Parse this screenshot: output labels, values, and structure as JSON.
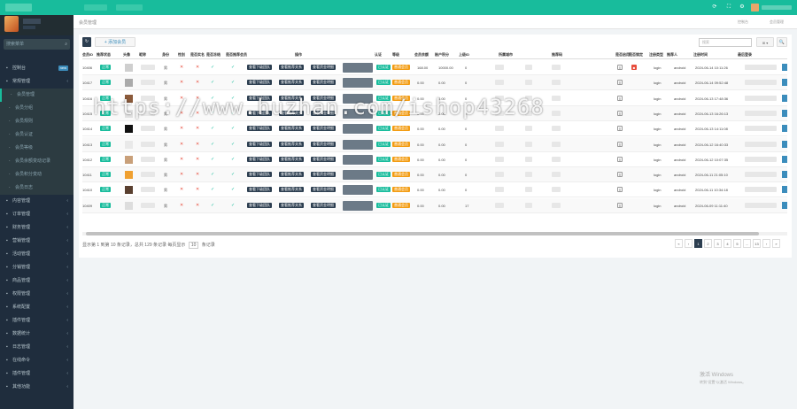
{
  "topbar": {
    "icons": [
      "refresh-icon",
      "fullscreen-icon",
      "settings-icon"
    ]
  },
  "sidebar": {
    "search_placeholder": "搜索菜单",
    "items": [
      {
        "label": "控制台",
        "icon": "home-icon",
        "badge": "new"
      },
      {
        "label": "常规管理",
        "icon": "cog-icon",
        "expanded": true
      },
      {
        "label": "会员管理",
        "icon": "user-icon",
        "active": true,
        "sub": true
      },
      {
        "label": "会员分组",
        "sub": true
      },
      {
        "label": "会员规则",
        "sub": true
      },
      {
        "label": "会员认证",
        "sub": true
      },
      {
        "label": "会员等级",
        "sub": true
      },
      {
        "label": "会员余额变动记录",
        "sub": true
      },
      {
        "label": "会员积分变动",
        "sub": true
      },
      {
        "label": "会员日志",
        "sub": true
      },
      {
        "label": "内容管理"
      },
      {
        "label": "订单管理"
      },
      {
        "label": "财务管理"
      },
      {
        "label": "营销管理"
      },
      {
        "label": "活动管理"
      },
      {
        "label": "分销管理"
      },
      {
        "label": "商品管理"
      },
      {
        "label": "权限管理"
      },
      {
        "label": "系统配置"
      },
      {
        "label": "插件管理"
      },
      {
        "label": "数据统计"
      },
      {
        "label": "日志管理"
      },
      {
        "label": "在线命令"
      },
      {
        "label": "插件管理"
      },
      {
        "label": "其他功能"
      }
    ]
  },
  "crumbbar": {
    "title": "会员管理",
    "tab_a": "控制台",
    "tab_b": "会员管理"
  },
  "toolbar": {
    "refresh_label": "↻",
    "add_label": "+ 添加会员",
    "search_placeholder": "搜索",
    "columns_label": "⊞ ▾",
    "search_label": "🔍"
  },
  "table": {
    "headers": [
      "会员ID",
      "推荐状态",
      "头像",
      "昵称",
      "身份",
      "性别",
      "是否实名",
      "是否冻结",
      "是否推荐会员",
      "操作",
      "",
      "",
      "认证",
      "等级",
      "会员余额",
      "账户积分",
      "上级ID",
      "",
      "所属城市",
      "推荐码",
      "是否启用",
      "是否锁定",
      "注册类型",
      "推荐人",
      "注册时间",
      "最后登录"
    ],
    "rows": [
      {
        "id": "10406",
        "status": "正常",
        "c1": "男",
        "rz": "已认证",
        "lv": "普通会员",
        "money": "168.00",
        "score": "10000.00",
        "up": "0",
        "ctype": "login",
        "ref": "android",
        "time": "2024-06-14 10:11:26"
      },
      {
        "id": "10417",
        "status": "正常",
        "c1": "男",
        "rz": "已认证",
        "lv": "普通会员",
        "money": "0.00",
        "score": "0.00",
        "up": "0",
        "ctype": "login",
        "ref": "android",
        "time": "2024-06-14 09:52:48"
      },
      {
        "id": "10416",
        "status": "正常",
        "c1": "男",
        "rz": "已认证",
        "lv": "普通会员",
        "money": "0.00",
        "score": "0.00",
        "up": "0",
        "ctype": "login",
        "ref": "android",
        "time": "2024-06-13 17:48:36"
      },
      {
        "id": "10415",
        "status": "正常",
        "c1": "男",
        "rz": "已认证",
        "lv": "普通会员",
        "money": "0.00",
        "score": "0.00",
        "up": "0",
        "ctype": "login",
        "ref": "android",
        "time": "2024-06-13 16:26:13"
      },
      {
        "id": "10414",
        "status": "正常",
        "c1": "男",
        "rz": "已认证",
        "lv": "普通会员",
        "money": "0.00",
        "score": "0.00",
        "up": "0",
        "ctype": "login",
        "ref": "android",
        "time": "2024-06-13 14:11:08"
      },
      {
        "id": "10413",
        "status": "正常",
        "c1": "男",
        "rz": "已认证",
        "lv": "普通会员",
        "money": "0.00",
        "score": "0.00",
        "up": "0",
        "ctype": "login",
        "ref": "android",
        "time": "2024-06-12 16:40:33"
      },
      {
        "id": "10412",
        "status": "正常",
        "c1": "男",
        "rz": "已认证",
        "lv": "普通会员",
        "money": "0.00",
        "score": "0.00",
        "up": "0",
        "ctype": "login",
        "ref": "android",
        "time": "2024-06-12 10:07:35"
      },
      {
        "id": "10411",
        "status": "正常",
        "c1": "男",
        "rz": "已认证",
        "lv": "普通会员",
        "money": "0.00",
        "score": "0.00",
        "up": "0",
        "ctype": "login",
        "ref": "android",
        "time": "2024-06-11 21:05:10"
      },
      {
        "id": "10410",
        "status": "正常",
        "c1": "男",
        "rz": "已认证",
        "lv": "普通会员",
        "money": "0.00",
        "score": "0.00",
        "up": "0",
        "ctype": "login",
        "ref": "android",
        "time": "2024-06-11 10:34:18"
      },
      {
        "id": "10409",
        "status": "正常",
        "c1": "男",
        "rz": "已认证",
        "lv": "普通会员",
        "money": "0.00",
        "score": "0.00",
        "up": "17",
        "ctype": "login",
        "ref": "android",
        "time": "2024-06-09 11:11:40"
      }
    ],
    "action_labels": [
      "查看下级团队",
      "查看推荐关系",
      "查看资金明细"
    ]
  },
  "pager": {
    "info_prefix": "显示第 1 到第 10 条记录，总共 129 条记录 每页显示",
    "per_page": "10",
    "info_suffix": "条记录",
    "pages": [
      "«",
      "‹",
      "1",
      "2",
      "3",
      "4",
      "5",
      "...",
      "13",
      "›",
      "»"
    ],
    "active": "1"
  },
  "watermark": "https://www.huzhan.com/ishop43268",
  "windows_activation": {
    "title": "激活 Windows",
    "sub": "转到\"设置\"以激活 Windows。"
  },
  "colors": {
    "brand": "#18bc9c",
    "sidebar_bg": "#1f2d3d",
    "dark_button": "#2c3e50",
    "warning": "#f39c12",
    "danger": "#e74c3c"
  }
}
